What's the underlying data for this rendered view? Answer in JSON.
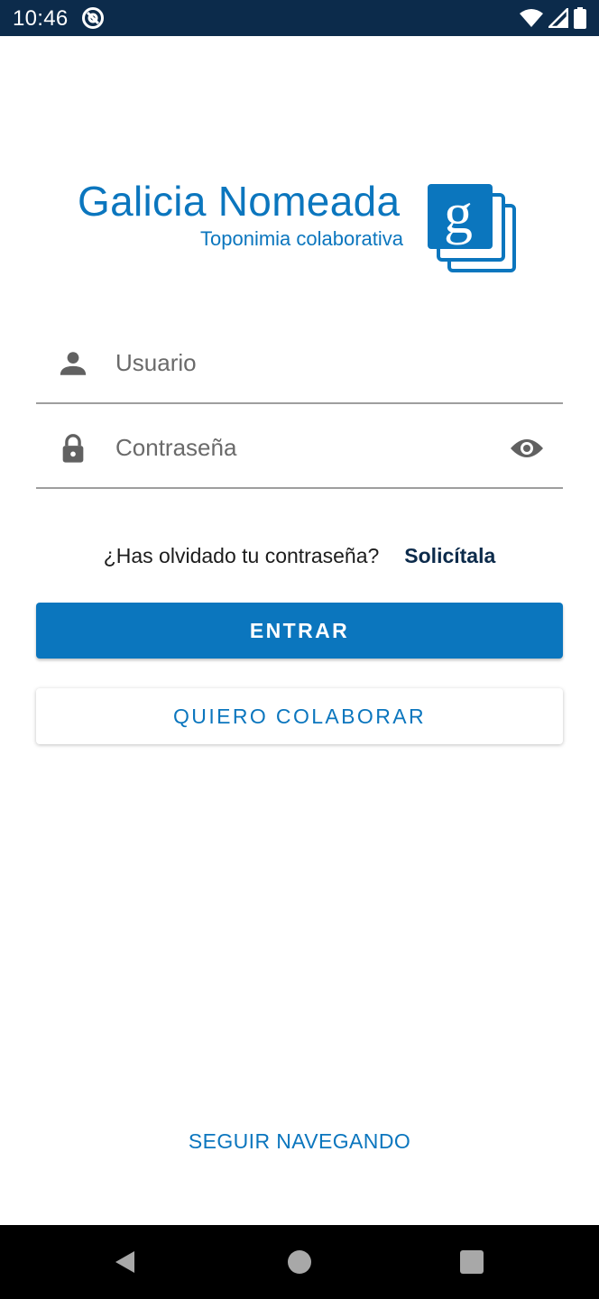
{
  "status_bar": {
    "time": "10:46",
    "icons": [
      "at-sign-icon",
      "wifi-icon",
      "signal-icon",
      "battery-icon"
    ]
  },
  "logo": {
    "title": "Galicia Nomeada",
    "subtitle": "Toponimia colaborativa",
    "mark_letter": "g",
    "brand_color": "#0b76be"
  },
  "form": {
    "username": {
      "placeholder": "Usuario",
      "value": "",
      "icon": "person-icon"
    },
    "password": {
      "placeholder": "Contraseña",
      "value": "",
      "icon": "lock-icon",
      "toggle_icon": "eye-icon"
    }
  },
  "forgot": {
    "text": "¿Has olvidado tu contraseña?",
    "link": "Solicítala"
  },
  "buttons": {
    "login": "ENTRAR",
    "collaborate": "QUIERO COLABORAR"
  },
  "browse_link": "SEGUIR NAVEGANDO",
  "colors": {
    "accent": "#0b76be",
    "status_bar": "#0c2b4b",
    "link_dark": "#0c2b4b"
  },
  "nav_bar": {
    "icons": [
      "back-icon",
      "home-icon",
      "recents-icon"
    ]
  }
}
